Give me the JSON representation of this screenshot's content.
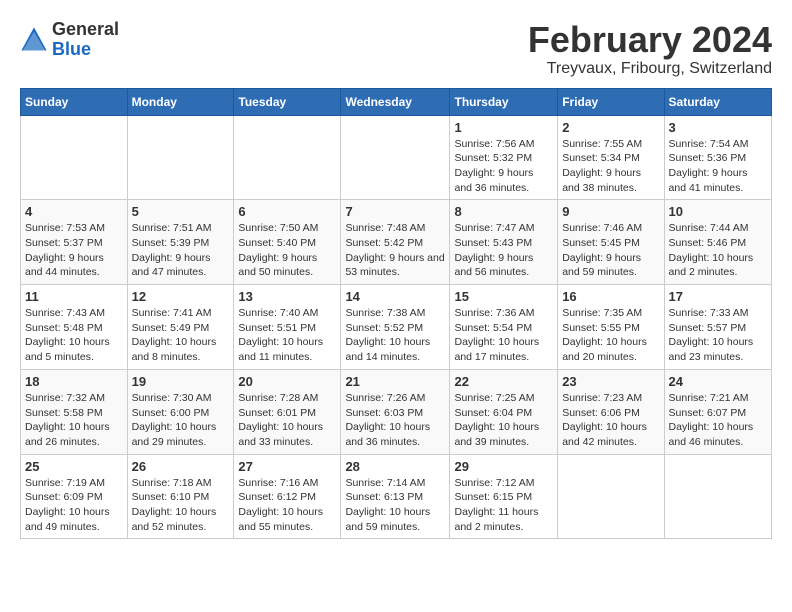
{
  "header": {
    "logo_general": "General",
    "logo_blue": "Blue",
    "main_title": "February 2024",
    "subtitle": "Treyvaux, Fribourg, Switzerland"
  },
  "calendar": {
    "days_of_week": [
      "Sunday",
      "Monday",
      "Tuesday",
      "Wednesday",
      "Thursday",
      "Friday",
      "Saturday"
    ],
    "weeks": [
      [
        {
          "day": "",
          "info": ""
        },
        {
          "day": "",
          "info": ""
        },
        {
          "day": "",
          "info": ""
        },
        {
          "day": "",
          "info": ""
        },
        {
          "day": "1",
          "info": "Sunrise: 7:56 AM\nSunset: 5:32 PM\nDaylight: 9 hours and 36 minutes."
        },
        {
          "day": "2",
          "info": "Sunrise: 7:55 AM\nSunset: 5:34 PM\nDaylight: 9 hours and 38 minutes."
        },
        {
          "day": "3",
          "info": "Sunrise: 7:54 AM\nSunset: 5:36 PM\nDaylight: 9 hours and 41 minutes."
        }
      ],
      [
        {
          "day": "4",
          "info": "Sunrise: 7:53 AM\nSunset: 5:37 PM\nDaylight: 9 hours and 44 minutes."
        },
        {
          "day": "5",
          "info": "Sunrise: 7:51 AM\nSunset: 5:39 PM\nDaylight: 9 hours and 47 minutes."
        },
        {
          "day": "6",
          "info": "Sunrise: 7:50 AM\nSunset: 5:40 PM\nDaylight: 9 hours and 50 minutes."
        },
        {
          "day": "7",
          "info": "Sunrise: 7:48 AM\nSunset: 5:42 PM\nDaylight: 9 hours and 53 minutes."
        },
        {
          "day": "8",
          "info": "Sunrise: 7:47 AM\nSunset: 5:43 PM\nDaylight: 9 hours and 56 minutes."
        },
        {
          "day": "9",
          "info": "Sunrise: 7:46 AM\nSunset: 5:45 PM\nDaylight: 9 hours and 59 minutes."
        },
        {
          "day": "10",
          "info": "Sunrise: 7:44 AM\nSunset: 5:46 PM\nDaylight: 10 hours and 2 minutes."
        }
      ],
      [
        {
          "day": "11",
          "info": "Sunrise: 7:43 AM\nSunset: 5:48 PM\nDaylight: 10 hours and 5 minutes."
        },
        {
          "day": "12",
          "info": "Sunrise: 7:41 AM\nSunset: 5:49 PM\nDaylight: 10 hours and 8 minutes."
        },
        {
          "day": "13",
          "info": "Sunrise: 7:40 AM\nSunset: 5:51 PM\nDaylight: 10 hours and 11 minutes."
        },
        {
          "day": "14",
          "info": "Sunrise: 7:38 AM\nSunset: 5:52 PM\nDaylight: 10 hours and 14 minutes."
        },
        {
          "day": "15",
          "info": "Sunrise: 7:36 AM\nSunset: 5:54 PM\nDaylight: 10 hours and 17 minutes."
        },
        {
          "day": "16",
          "info": "Sunrise: 7:35 AM\nSunset: 5:55 PM\nDaylight: 10 hours and 20 minutes."
        },
        {
          "day": "17",
          "info": "Sunrise: 7:33 AM\nSunset: 5:57 PM\nDaylight: 10 hours and 23 minutes."
        }
      ],
      [
        {
          "day": "18",
          "info": "Sunrise: 7:32 AM\nSunset: 5:58 PM\nDaylight: 10 hours and 26 minutes."
        },
        {
          "day": "19",
          "info": "Sunrise: 7:30 AM\nSunset: 6:00 PM\nDaylight: 10 hours and 29 minutes."
        },
        {
          "day": "20",
          "info": "Sunrise: 7:28 AM\nSunset: 6:01 PM\nDaylight: 10 hours and 33 minutes."
        },
        {
          "day": "21",
          "info": "Sunrise: 7:26 AM\nSunset: 6:03 PM\nDaylight: 10 hours and 36 minutes."
        },
        {
          "day": "22",
          "info": "Sunrise: 7:25 AM\nSunset: 6:04 PM\nDaylight: 10 hours and 39 minutes."
        },
        {
          "day": "23",
          "info": "Sunrise: 7:23 AM\nSunset: 6:06 PM\nDaylight: 10 hours and 42 minutes."
        },
        {
          "day": "24",
          "info": "Sunrise: 7:21 AM\nSunset: 6:07 PM\nDaylight: 10 hours and 46 minutes."
        }
      ],
      [
        {
          "day": "25",
          "info": "Sunrise: 7:19 AM\nSunset: 6:09 PM\nDaylight: 10 hours and 49 minutes."
        },
        {
          "day": "26",
          "info": "Sunrise: 7:18 AM\nSunset: 6:10 PM\nDaylight: 10 hours and 52 minutes."
        },
        {
          "day": "27",
          "info": "Sunrise: 7:16 AM\nSunset: 6:12 PM\nDaylight: 10 hours and 55 minutes."
        },
        {
          "day": "28",
          "info": "Sunrise: 7:14 AM\nSunset: 6:13 PM\nDaylight: 10 hours and 59 minutes."
        },
        {
          "day": "29",
          "info": "Sunrise: 7:12 AM\nSunset: 6:15 PM\nDaylight: 11 hours and 2 minutes."
        },
        {
          "day": "",
          "info": ""
        },
        {
          "day": "",
          "info": ""
        }
      ]
    ]
  }
}
